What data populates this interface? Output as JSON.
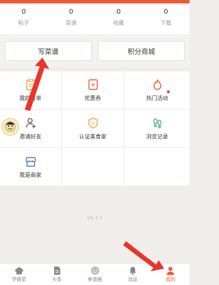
{
  "stats": [
    {
      "value": "0",
      "label": "帖子"
    },
    {
      "value": "0",
      "label": "菜谱"
    },
    {
      "value": "0",
      "label": "收藏"
    },
    {
      "value": "0",
      "label": "下载"
    }
  ],
  "actions": {
    "write_recipe": "写菜谱",
    "points_mall": "积分商城"
  },
  "grid": [
    {
      "label": "我的订单",
      "icon": "order-icon"
    },
    {
      "label": "优惠券",
      "icon": "coupon-icon"
    },
    {
      "label": "热门活动",
      "icon": "fire-icon"
    },
    {
      "label": "邀请好友",
      "icon": "invite-icon"
    },
    {
      "label": "认证美食家",
      "icon": "certify-icon"
    },
    {
      "label": "浏览记录",
      "icon": "footprint-icon"
    },
    {
      "label": "我是商家",
      "icon": "shop-icon"
    }
  ],
  "version": "V4.3.1",
  "tabs": [
    {
      "label": "学做菜",
      "icon": "chef-hat-icon"
    },
    {
      "label": "头条",
      "icon": "document-icon"
    },
    {
      "label": "美食圈",
      "icon": "smile-icon"
    },
    {
      "label": "消息",
      "icon": "bell-icon"
    },
    {
      "label": "我的",
      "icon": "person-icon",
      "active": true
    }
  ],
  "colors": {
    "accent": "#f15a36",
    "icon_orange": "#f0a030",
    "icon_green": "#3aa776"
  }
}
